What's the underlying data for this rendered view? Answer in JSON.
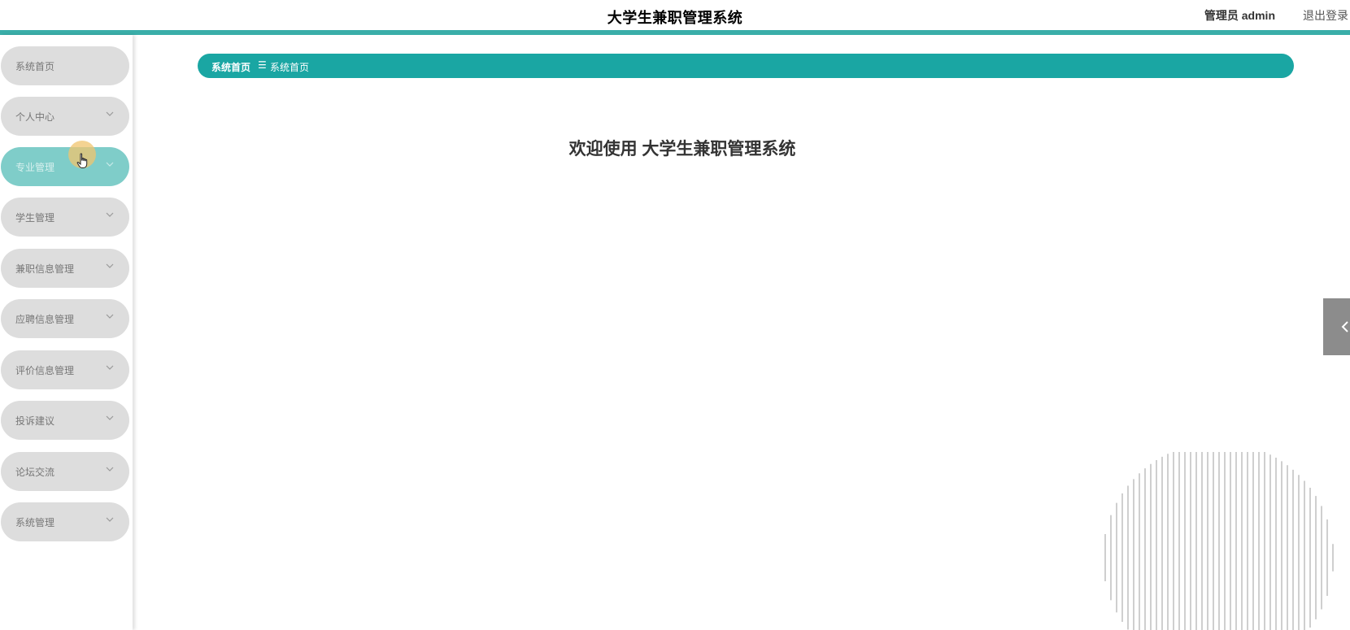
{
  "header": {
    "title": "大学生兼职管理系统",
    "user_label": "管理员 admin",
    "logout_label": "退出登录"
  },
  "sidebar": {
    "items": [
      {
        "label": "系统首页",
        "has_arrow": false,
        "active": false
      },
      {
        "label": "个人中心",
        "has_arrow": true,
        "active": false
      },
      {
        "label": "专业管理",
        "has_arrow": true,
        "active": true
      },
      {
        "label": "学生管理",
        "has_arrow": true,
        "active": false
      },
      {
        "label": "兼职信息管理",
        "has_arrow": true,
        "active": false
      },
      {
        "label": "应聘信息管理",
        "has_arrow": true,
        "active": false
      },
      {
        "label": "评价信息管理",
        "has_arrow": true,
        "active": false
      },
      {
        "label": "投诉建议",
        "has_arrow": true,
        "active": false
      },
      {
        "label": "论坛交流",
        "has_arrow": true,
        "active": false
      },
      {
        "label": "系统管理",
        "has_arrow": true,
        "active": false
      }
    ]
  },
  "breadcrumb": {
    "first": "系统首页",
    "separator": "☰",
    "second": "系统首页"
  },
  "main": {
    "welcome": "欢迎使用 大学生兼职管理系统"
  },
  "icons": {
    "menu_arrow": "chevron-down-icon",
    "side_toggle": "chevron-left-icon",
    "cursor": "hand-pointer-icon"
  },
  "colors": {
    "accent": "#1aa6a3",
    "accent_line": "#3aaea9",
    "menu_bg": "#dddddd",
    "menu_active_bg": "#7fcdc9",
    "side_tab_bg": "#8c8c8c"
  }
}
